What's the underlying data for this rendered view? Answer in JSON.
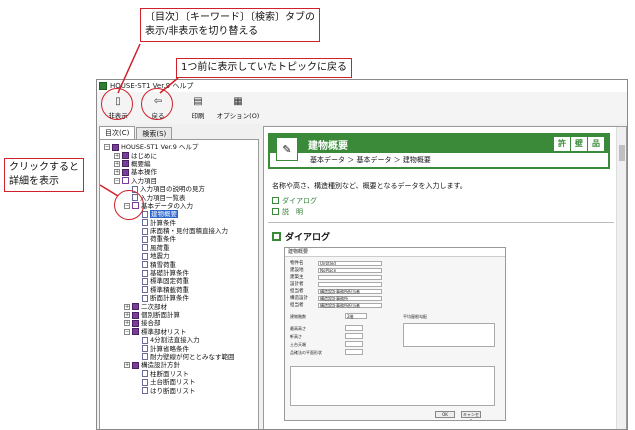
{
  "window": {
    "title": "HOUSE-ST1 Ver.9 ヘルプ"
  },
  "toolbar": {
    "buttons": [
      {
        "label": "非表示",
        "icon": "hide-pane-icon"
      },
      {
        "label": "戻る",
        "icon": "back-arrow-icon"
      },
      {
        "label": "印刷",
        "icon": "printer-icon"
      },
      {
        "label": "オプション(O)",
        "icon": "options-icon"
      }
    ]
  },
  "tabs": [
    {
      "label": "目次(C)",
      "active": true
    },
    {
      "label": "検索(S)",
      "active": false
    }
  ],
  "tree": [
    {
      "label": "HOUSE-ST1 Ver.9 ヘルプ",
      "level": 0,
      "type": "book",
      "expander": "-"
    },
    {
      "label": "はじめに",
      "level": 1,
      "type": "book",
      "expander": "+"
    },
    {
      "label": "概要編",
      "level": 1,
      "type": "book",
      "expander": "+"
    },
    {
      "label": "基本操作",
      "level": 1,
      "type": "book",
      "expander": "+"
    },
    {
      "label": "入力項目",
      "level": 1,
      "type": "book-open",
      "expander": "-"
    },
    {
      "label": "入力項目の説明の見方",
      "level": 2,
      "type": "page",
      "expander": ""
    },
    {
      "label": "入力項目一覧表",
      "level": 2,
      "type": "page",
      "expander": ""
    },
    {
      "label": "基本データの入力",
      "level": 2,
      "type": "book-open",
      "expander": "-"
    },
    {
      "label": "建物概要",
      "level": 3,
      "type": "page",
      "expander": "",
      "selected": true
    },
    {
      "label": "計算条件",
      "level": 3,
      "type": "page",
      "expander": ""
    },
    {
      "label": "床面積・見付面積直接入力",
      "level": 3,
      "type": "page",
      "expander": ""
    },
    {
      "label": "荷重条件",
      "level": 3,
      "type": "page",
      "expander": ""
    },
    {
      "label": "風荷重",
      "level": 3,
      "type": "page",
      "expander": ""
    },
    {
      "label": "地震力",
      "level": 3,
      "type": "page",
      "expander": ""
    },
    {
      "label": "積雪荷重",
      "level": 3,
      "type": "page",
      "expander": ""
    },
    {
      "label": "基礎計算条件",
      "level": 3,
      "type": "page",
      "expander": ""
    },
    {
      "label": "標準固定荷重",
      "level": 3,
      "type": "page",
      "expander": ""
    },
    {
      "label": "標準積載荷重",
      "level": 3,
      "type": "page",
      "expander": ""
    },
    {
      "label": "断面計算条件",
      "level": 3,
      "type": "page",
      "expander": ""
    },
    {
      "label": "二次部材",
      "level": 2,
      "type": "book",
      "expander": "+"
    },
    {
      "label": "個別断面計算",
      "level": 2,
      "type": "book",
      "expander": "+"
    },
    {
      "label": "接合部",
      "level": 2,
      "type": "book",
      "expander": "+"
    },
    {
      "label": "標準部材リスト",
      "level": 2,
      "type": "book",
      "expander": "-"
    },
    {
      "label": "4分割法直接入力",
      "level": 3,
      "type": "page",
      "expander": ""
    },
    {
      "label": "計算省略条件",
      "level": 3,
      "type": "page",
      "expander": ""
    },
    {
      "label": "耐力壁線が何ととみなす範囲",
      "level": 3,
      "type": "page",
      "expander": ""
    },
    {
      "label": "構造設計方針",
      "level": 2,
      "type": "book",
      "expander": "+"
    },
    {
      "label": "柱断面リスト",
      "level": 3,
      "type": "page",
      "expander": ""
    },
    {
      "label": "土台断面リスト",
      "level": 3,
      "type": "page",
      "expander": ""
    },
    {
      "label": "はり断面リスト",
      "level": 3,
      "type": "page",
      "expander": ""
    }
  ],
  "content": {
    "title": "建物概要",
    "chips": [
      "許",
      "壁",
      "品"
    ],
    "breadcrumb": "基本データ ＞ 基本データ ＞ 建物概要",
    "description": "名称や高さ、構造種別など、概要となるデータを入力します。",
    "links": [
      "ダイアログ",
      "説　明"
    ],
    "section_title": "ダイアログ"
  },
  "dialog": {
    "title": "建物概要",
    "fields": [
      {
        "k": "物件名",
        "v": "Untitled"
      },
      {
        "k": "建設地",
        "v": "NoPlace"
      },
      {
        "k": "建築主",
        "v": ""
      },
      {
        "k": "設計者",
        "v": ""
      },
      {
        "k": "担当者",
        "v": "構造設計事務所担当者"
      },
      {
        "k": "構造設計",
        "v": "構造設計事務所"
      },
      {
        "k": "担当者",
        "v": "構造設計事務所担当者"
      }
    ],
    "labels": {
      "structure": "建物階数",
      "floors": "2階",
      "roof_pitch": "平均屋根勾配",
      "top_floor": "最高高さ",
      "eaves": "軒高さ",
      "floor_h": "土台天端",
      "base": "品確法の平面形状",
      "ok": "OK",
      "cancel": "キャンセル"
    }
  },
  "annotations": {
    "tab_toggle": "〔目次〕〔キーワード〕〔検索〕タブの\n表示/非表示を切り替える",
    "back": "1つ前に表示していたトピックに戻る",
    "detail": "クリックすると\n詳細を表示"
  }
}
